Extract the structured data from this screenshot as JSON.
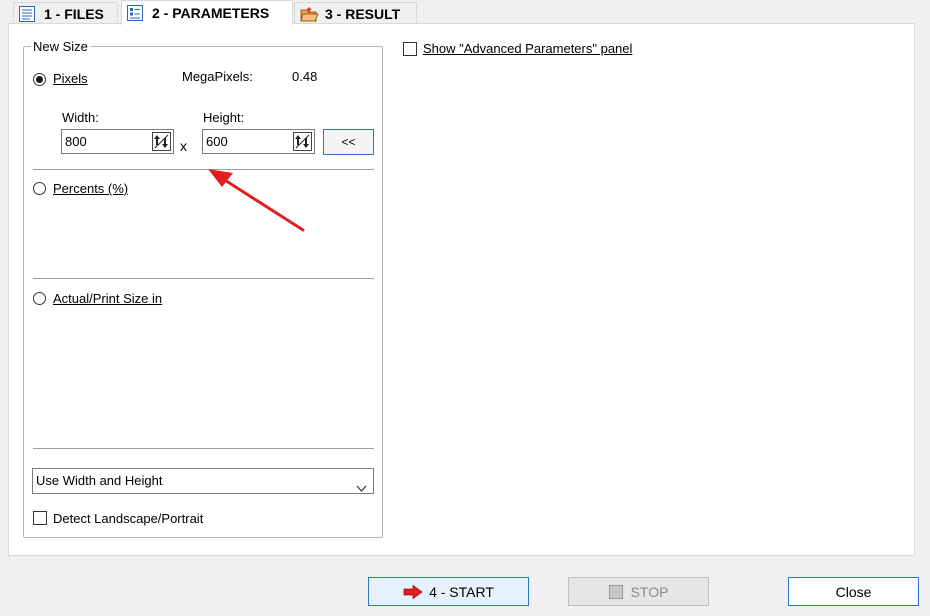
{
  "tabs": [
    {
      "label": "1 - FILES",
      "active": false
    },
    {
      "label": "2 - PARAMETERS",
      "active": true
    },
    {
      "label": "3 - RESULT",
      "active": false
    }
  ],
  "new_size": {
    "title": "New Size",
    "pixels": {
      "label": "Pixels",
      "selected": true,
      "megapixels_label": "MegaPixels:",
      "megapixels_value": "0.48",
      "width_label": "Width:",
      "width_value": "800",
      "height_label": "Height:",
      "height_value": "600",
      "times_symbol": "x",
      "swap_label": "<<"
    },
    "percents": {
      "label": "Percents (%)",
      "selected": false
    },
    "actual_print": {
      "label": "Actual/Print Size in",
      "selected": false
    },
    "mode_select": {
      "value": "Use Width and Height"
    },
    "detect_landscape": {
      "label": "Detect Landscape/Portrait",
      "checked": false
    }
  },
  "advanced": {
    "label": "Show \"Advanced Parameters\" panel",
    "checked": false
  },
  "buttons": {
    "start": "4 - START",
    "stop": "STOP",
    "close": "Close"
  },
  "annotation": {
    "arrow_color": "#e02020"
  }
}
